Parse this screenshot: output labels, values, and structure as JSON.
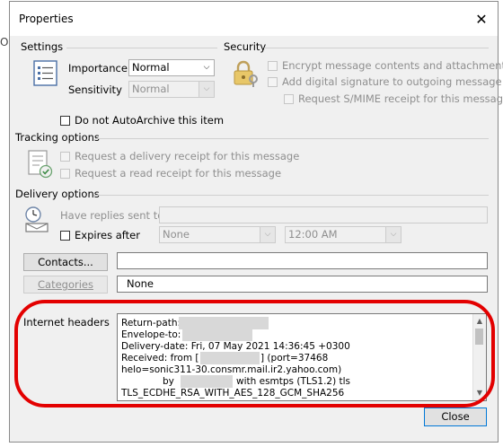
{
  "dialog": {
    "title": "Properties",
    "close_glyph": "✕"
  },
  "outside": {
    "left_glyph": "O"
  },
  "settings": {
    "header": "Settings",
    "importance_label": "Importance",
    "importance_value": "Normal",
    "sensitivity_label": "Sensitivity",
    "sensitivity_value": "Normal",
    "autoarchive_label": "Do not AutoArchive this item"
  },
  "security": {
    "header": "Security",
    "encrypt_label": "Encrypt message contents and attachments",
    "signature_label": "Add digital signature to outgoing message",
    "smime_label": "Request S/MIME receipt for this message"
  },
  "tracking": {
    "header": "Tracking options",
    "delivery_receipt_label": "Request a delivery receipt for this message",
    "read_receipt_label": "Request a read receipt for this message"
  },
  "delivery": {
    "header": "Delivery options",
    "replies_label": "Have replies sent to",
    "replies_value": "",
    "expires_label": "Expires after",
    "expires_date": "None",
    "expires_time": "12:00 AM",
    "contacts_button": "Contacts...",
    "contacts_value": "",
    "categories_button": "Categories",
    "categories_value": "None"
  },
  "internet_headers": {
    "label": "Internet headers",
    "lines": [
      "Return-path:",
      "Envelope-to:",
      "Delivery-date: Fri, 07 May 2021 14:36:45 +0300",
      "Received: from [",
      "helo=sonic311-30.consmr.mail.ir2.yahoo.com)",
      "by",
      "TLS_ECDHE_RSA_WITH_AES_128_GCM_SHA256"
    ],
    "received_suffix": "] (port=37468",
    "by_suffix": "with esmtps  (TLS1.2) tls"
  },
  "footer": {
    "close_button": "Close"
  },
  "colors": {
    "annotation_ring": "#e30000",
    "dialog_bg": "#f0f0f0"
  }
}
